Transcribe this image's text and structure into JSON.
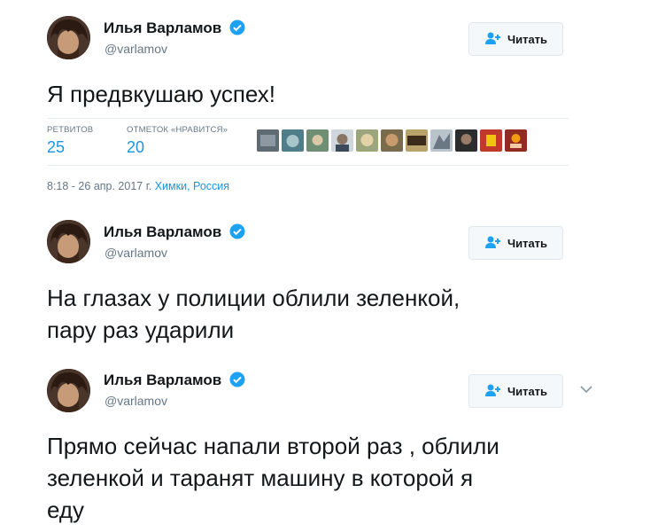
{
  "tweets": [
    {
      "author": "Илья Варламов",
      "handle": "@varlamov",
      "follow_label": "Читать",
      "text": "Я предвкушаю успех!",
      "stats": {
        "retweets_label": "РЕТВИТОВ",
        "retweets": "25",
        "likes_label": "ОТМЕТОК «НРАВИТСЯ»",
        "likes": "20"
      },
      "likers": [
        "liker-avatar-1",
        "liker-avatar-2",
        "liker-avatar-3",
        "liker-avatar-4",
        "liker-avatar-5",
        "liker-avatar-6",
        "liker-avatar-7",
        "liker-avatar-8",
        "liker-avatar-9",
        "liker-avatar-10"
      ],
      "timestamp": "8:18 - 26 апр. 2017 г.",
      "location": "Химки, Россия"
    },
    {
      "author": "Илья Варламов",
      "handle": "@varlamov",
      "follow_label": "Читать",
      "text_line1": "На глазах у полиции облили зеленкой,",
      "text_line2": "пару раз ударили"
    },
    {
      "author": "Илья Варламов",
      "handle": "@varlamov",
      "follow_label": "Читать",
      "text_line1": "Прямо сейчас напали второй раз , облили",
      "text_line2": "зеленкой и таранят машину в которой я",
      "text_line3": "еду"
    }
  ],
  "icons": {
    "verified": "verified-badge-icon",
    "follow": "add-user-icon",
    "more": "chevron-down-icon"
  },
  "colors": {
    "accent": "#1da1f2",
    "stat_value": "#1b95e0",
    "muted": "#657786"
  }
}
